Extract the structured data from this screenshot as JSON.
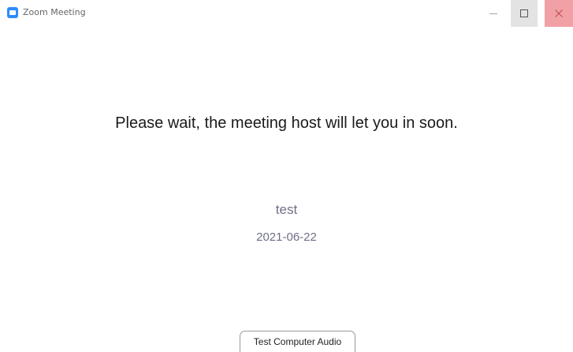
{
  "window": {
    "title": "Zoom Meeting",
    "icon": "zoom-camera-icon",
    "controls": {
      "minimize_icon": "minimize-icon",
      "maximize_icon": "maximize-icon",
      "close_icon": "close-icon"
    }
  },
  "main": {
    "message": "Please wait, the meeting host will let you in soon.",
    "meeting_topic": "test",
    "meeting_date": "2021-06-22"
  },
  "footer": {
    "test_audio_label": "Test Computer Audio"
  },
  "colors": {
    "brand": "#2d8cff",
    "close_hover": "#f1a1a5",
    "meeting_info_text": "#6e6f86"
  }
}
